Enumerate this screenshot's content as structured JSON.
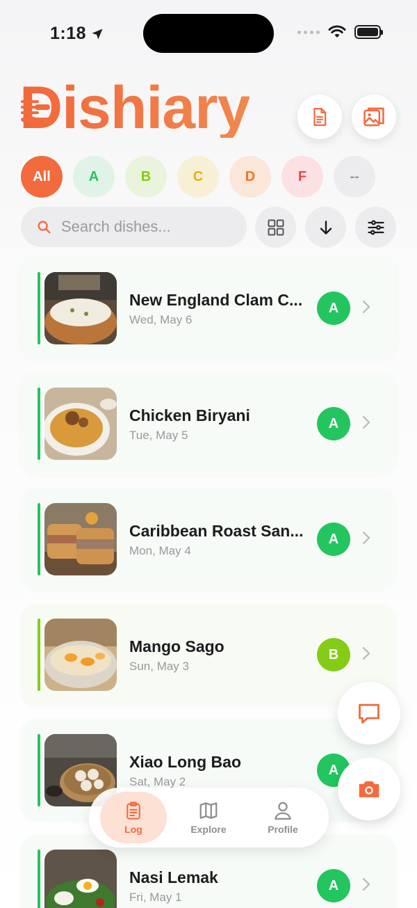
{
  "status_bar": {
    "time": "1:18"
  },
  "header": {
    "app_name": "Dishiary"
  },
  "colors": {
    "accent": "#f36a3d",
    "grade_a": "#22c55e",
    "grade_b": "#84cc16",
    "grade_c": "#eab308",
    "grade_d": "#f97316",
    "grade_f": "#ef4444"
  },
  "filters": [
    {
      "label": "All",
      "selected": true
    },
    {
      "label": "A"
    },
    {
      "label": "B"
    },
    {
      "label": "C"
    },
    {
      "label": "D"
    },
    {
      "label": "F"
    },
    {
      "label": "--"
    }
  ],
  "search": {
    "placeholder": "Search dishes..."
  },
  "dishes": [
    {
      "title": "New England Clam C...",
      "date": "Wed, May 6",
      "grade": "A"
    },
    {
      "title": "Chicken Biryani",
      "date": "Tue, May 5",
      "grade": "A"
    },
    {
      "title": "Caribbean Roast San...",
      "date": "Mon, May 4",
      "grade": "A"
    },
    {
      "title": "Mango Sago",
      "date": "Sun, May 3",
      "grade": "B"
    },
    {
      "title": "Xiao Long Bao",
      "date": "Sat, May 2",
      "grade": "A"
    },
    {
      "title": "Nasi Lemak",
      "date": "Fri, May 1",
      "grade": "A"
    }
  ],
  "tabs": [
    {
      "label": "Log",
      "icon": "clipboard-icon",
      "active": true
    },
    {
      "label": "Explore",
      "icon": "map-icon"
    },
    {
      "label": "Profile",
      "icon": "person-icon"
    }
  ],
  "icons": {
    "header": [
      "document-icon",
      "gallery-icon"
    ],
    "search": "search-icon",
    "toolbar": [
      "grid-icon",
      "sort-down-icon",
      "filter-sliders-icon"
    ],
    "fabs": [
      "chat-icon",
      "camera-icon"
    ]
  }
}
